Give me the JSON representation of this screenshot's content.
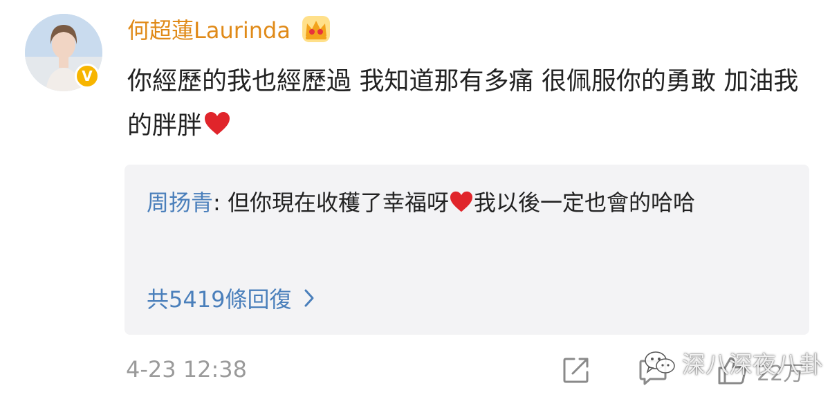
{
  "comment": {
    "username": "何超蓮Laurinda",
    "text": "你經歷的我也經歷過 我知道那有多痛 很佩服你的勇敢 加油我的胖胖",
    "reply": {
      "author": "周扬青",
      "separator": ": ",
      "text_before_heart": "但你現在收穫了幸福呀",
      "text_after_heart": "我以後一定也會的哈哈",
      "count_label": "共5419條回復"
    },
    "timestamp": "4-23 12:38",
    "like_count": "22万"
  },
  "watermark": {
    "text": "深八深夜八卦"
  },
  "icons": {
    "verified": "verified-badge-icon",
    "crown": "crown-icon",
    "heart": "heart-icon",
    "chevron": "chevron-right-icon",
    "share": "share-icon",
    "comment": "comment-icon",
    "like": "like-icon",
    "wechat": "wechat-icon"
  },
  "colors": {
    "username": "#e08a18",
    "reply_author": "#4a7fbb",
    "reply_background": "#f3f3f5",
    "muted": "#9a9a9a",
    "verified_badge": "#f7b500",
    "heart": "#e0252b"
  }
}
